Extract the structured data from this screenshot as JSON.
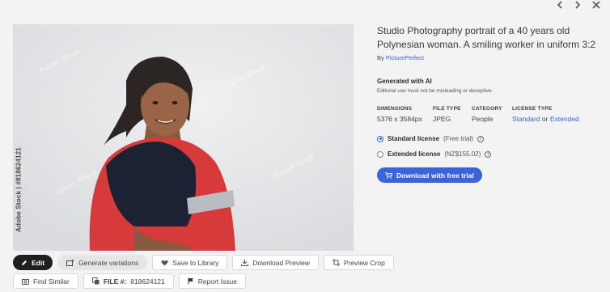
{
  "nav": {
    "prev_icon": "chevron-left-icon",
    "next_icon": "chevron-right-icon",
    "close_icon": "close-icon"
  },
  "image": {
    "watermark_side": "Adobe Stock | #818624121",
    "watermark_tile": "Adobe Stock"
  },
  "actions": {
    "edit": "Edit",
    "generate_variations": "Generate variations",
    "save_to_library": "Save to Library",
    "download_preview": "Download Preview",
    "preview_crop": "Preview Crop",
    "find_similar": "Find Similar",
    "file_label": "FILE #:",
    "file_number": "818624121",
    "report_issue": "Report Issue"
  },
  "details": {
    "title": "Studio Photography portrait of a 40 years old Polynesian woman. A smiling worker in uniform 3:2",
    "by_prefix": "By",
    "author": "PicturePerfect",
    "ai_heading": "Generated with AI",
    "ai_note": "Editorial use must not be misleading or deceptive.",
    "meta": {
      "dimensions_label": "DIMENSIONS",
      "dimensions_value": "5376 x 3584px",
      "filetype_label": "FILE TYPE",
      "filetype_value": "JPEG",
      "category_label": "CATEGORY",
      "category_value": "People",
      "license_label": "LICENSE TYPE",
      "license_standard": "Standard",
      "license_or": "or",
      "license_extended": "Extended"
    },
    "licenses": {
      "standard_label": "Standard license",
      "standard_note": "(Free trial)",
      "extended_label": "Extended license",
      "extended_note": "(NZ$155.02)",
      "selected": "standard"
    },
    "download_button": "Download with free trial"
  },
  "colors": {
    "accent": "#3b63db",
    "link": "#2f6ad7",
    "uniform_red": "#d63a3b",
    "uniform_navy": "#1c2233"
  }
}
